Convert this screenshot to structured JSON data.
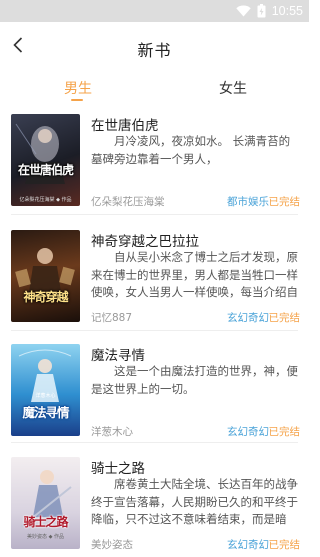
{
  "status_bar": {
    "time": "10:55"
  },
  "header": {
    "title": "新书"
  },
  "tabs": [
    {
      "label": "男生",
      "active": true
    },
    {
      "label": "女生",
      "active": false
    }
  ],
  "colors": {
    "accent": "#f5a34a",
    "genre": "#4aa3d8",
    "status_bar_bg": "#dddddd"
  },
  "books": [
    {
      "title": "在世唐伯虎",
      "description": "月冷凌风，夜凉如水。 长满青苔的墓碑旁边靠着一个男人，",
      "author": "亿朵梨花压海棠",
      "genre": "都市娱乐",
      "status": "已完结",
      "cover_title": "在世唐伯虎",
      "cover_subtitle": "亿朵梨花压海棠 ◆ 作品"
    },
    {
      "title": "神奇穿越之巴拉拉",
      "description": "自从吴小米念了博士之后才发现，原来在博士的世界里，男人都是当牲口一样使唤，女人当男人一样使唤，每当介绍自",
      "author": "记忆887",
      "genre": "玄幻奇幻",
      "status": "已完结",
      "cover_title": "神奇穿越",
      "cover_subtitle": ""
    },
    {
      "title": "魔法寻情",
      "description": "这是一个由魔法打造的世界，神，便是这世界上的一切。",
      "author": "洋葱木心",
      "genre": "玄幻奇幻",
      "status": "已完结",
      "cover_title": "魔法寻情",
      "cover_subtitle": "洋葱木心"
    },
    {
      "title": "骑士之路",
      "description": "席卷黄土大陆全境、长达百年的战争终于宣告落幕，人民期盼已久的和平终于降临，只不过这不意味着结束，而是暗示...",
      "author": "美妙姿态",
      "genre": "玄幻奇幻",
      "status": "已完结",
      "cover_title": "骑士之路",
      "cover_subtitle": "美妙姿态 ◆ 作品"
    }
  ]
}
